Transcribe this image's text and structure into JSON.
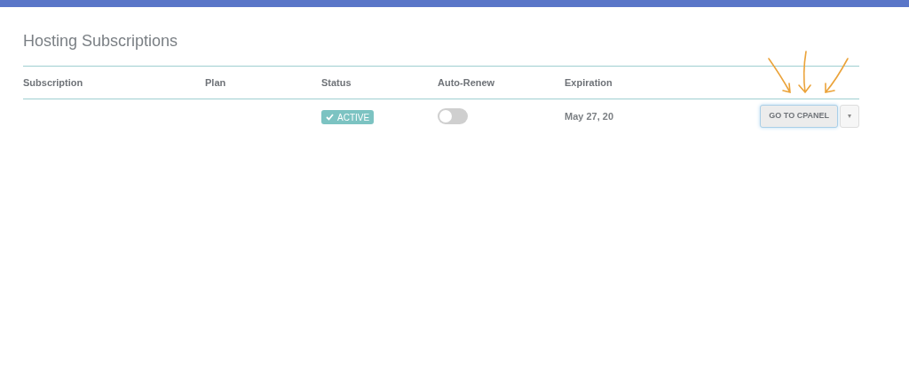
{
  "title": "Hosting Subscriptions",
  "table": {
    "columns": [
      "Subscription",
      "Plan",
      "Status",
      "Auto-Renew",
      "Expiration"
    ],
    "rows": [
      {
        "status": {
          "label": "ACTIVE",
          "kind": "active"
        },
        "auto_renew": {
          "on": false
        },
        "expiration": "May 27, 20",
        "action": "GO TO CPANEL",
        "dropdown": "▾"
      }
    ]
  }
}
